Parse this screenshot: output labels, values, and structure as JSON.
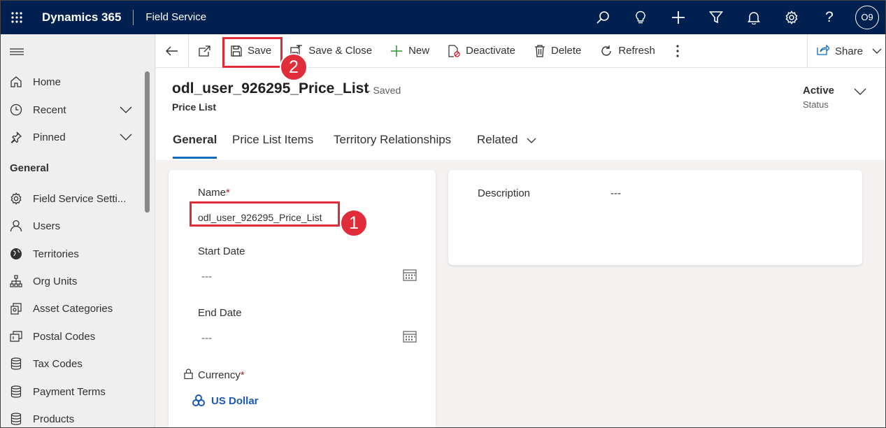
{
  "topbar": {
    "brand": "Dynamics 365",
    "app": "Field Service",
    "avatar": "O9",
    "icons": [
      "search-icon",
      "lightbulb-icon",
      "plus-icon",
      "filter-icon",
      "bell-icon",
      "gear-icon",
      "help-icon"
    ],
    "bg_color": "#002050"
  },
  "sidebar": {
    "items": [
      {
        "label": "Home",
        "icon": "home-icon"
      },
      {
        "label": "Recent",
        "icon": "clock-icon"
      },
      {
        "label": "Pinned",
        "icon": "pin-icon"
      }
    ],
    "group_label": "General",
    "group_items": [
      {
        "label": "Field Service Setti...",
        "icon": "gear-icon"
      },
      {
        "label": "Users",
        "icon": "person-icon"
      },
      {
        "label": "Territories",
        "icon": "globe-icon"
      },
      {
        "label": "Org Units",
        "icon": "org-chart-icon"
      },
      {
        "label": "Asset Categories",
        "icon": "asset-icon"
      },
      {
        "label": "Postal Codes",
        "icon": "postal-icon"
      },
      {
        "label": "Tax Codes",
        "icon": "database-icon"
      },
      {
        "label": "Payment Terms",
        "icon": "database-icon"
      },
      {
        "label": "Products",
        "icon": "database-icon"
      }
    ]
  },
  "commands": {
    "save": "Save",
    "save_close": "Save & Close",
    "new": "New",
    "deactivate": "Deactivate",
    "delete": "Delete",
    "refresh": "Refresh",
    "share": "Share"
  },
  "record": {
    "title": "odl_user_926295_Price_List",
    "saved_state": "- Saved",
    "entity": "Price List",
    "status_value": "Active",
    "status_label": "Status"
  },
  "tabs": [
    "General",
    "Price List Items",
    "Territory Relationships",
    "Related"
  ],
  "form": {
    "name_label": "Name",
    "name_value": "odl_user_926295_Price_List",
    "start_date_label": "Start Date",
    "start_date_value": "---",
    "end_date_label": "End Date",
    "end_date_value": "---",
    "currency_label": "Currency",
    "currency_value": "US Dollar",
    "required_mark": "*",
    "description_label": "Description",
    "description_value": "---"
  },
  "annotations": {
    "step1": "1",
    "step2": "2",
    "color": "#e12d39"
  }
}
